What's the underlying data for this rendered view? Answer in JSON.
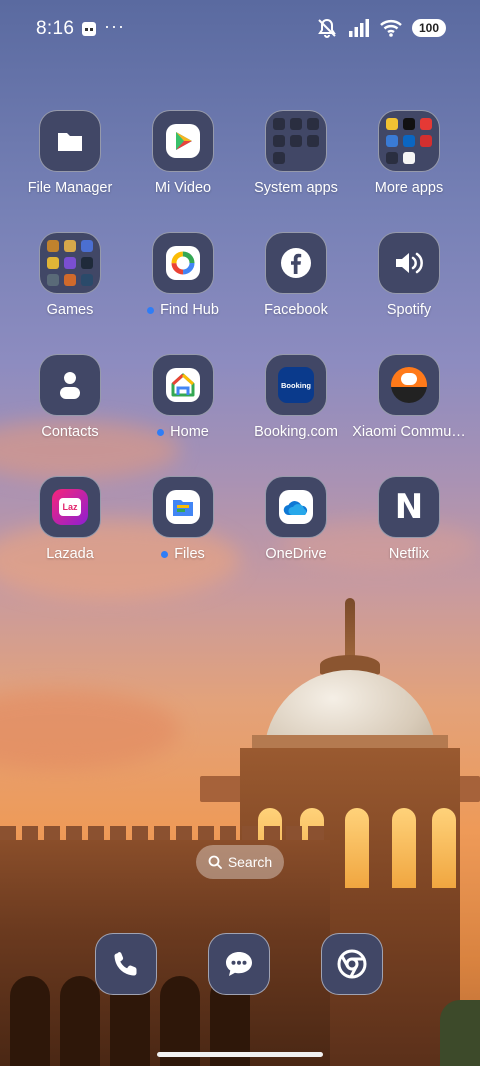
{
  "status_bar": {
    "time": "8:16",
    "more_indicator": "···",
    "battery": "100",
    "icons": [
      "notification-icon",
      "mute-icon",
      "signal-icon",
      "wifi-icon",
      "battery-icon"
    ]
  },
  "apps": [
    {
      "label": "File Manager",
      "icon": "folder-icon",
      "new_dot": false
    },
    {
      "label": "Mi Video",
      "icon": "play-icon",
      "new_dot": false
    },
    {
      "label": "System apps",
      "icon": "folder-grid-icon",
      "new_dot": false
    },
    {
      "label": "More apps",
      "icon": "folder-grid-icon",
      "new_dot": false
    },
    {
      "label": "Games",
      "icon": "folder-grid-icon",
      "new_dot": false
    },
    {
      "label": "Find Hub",
      "icon": "find-hub-icon",
      "new_dot": true
    },
    {
      "label": "Facebook",
      "icon": "facebook-icon",
      "new_dot": false
    },
    {
      "label": "Spotify",
      "icon": "speaker-icon",
      "new_dot": false
    },
    {
      "label": "Contacts",
      "icon": "person-icon",
      "new_dot": false
    },
    {
      "label": "Home",
      "icon": "home-icon",
      "new_dot": true
    },
    {
      "label": "Booking.com",
      "icon": "booking-icon",
      "new_dot": false
    },
    {
      "label": "Xiaomi Commu…",
      "icon": "xiaomi-community-icon",
      "new_dot": false
    },
    {
      "label": "Lazada",
      "icon": "lazada-icon",
      "new_dot": false
    },
    {
      "label": "Files",
      "icon": "files-icon",
      "new_dot": true
    },
    {
      "label": "OneDrive",
      "icon": "onedrive-icon",
      "new_dot": false
    },
    {
      "label": "Netflix",
      "icon": "netflix-icon",
      "new_dot": false
    }
  ],
  "icon_text": {
    "booking": "Booking",
    "lazada": "Laz",
    "netflix": "N"
  },
  "search": {
    "label": "Search"
  },
  "dock": [
    "phone-icon",
    "messages-icon",
    "chrome-icon"
  ],
  "colors": {
    "tile": "#414766",
    "new_dot": "#2f7df6",
    "booking": "#0a3a8c",
    "lazada": "#e2246c"
  }
}
